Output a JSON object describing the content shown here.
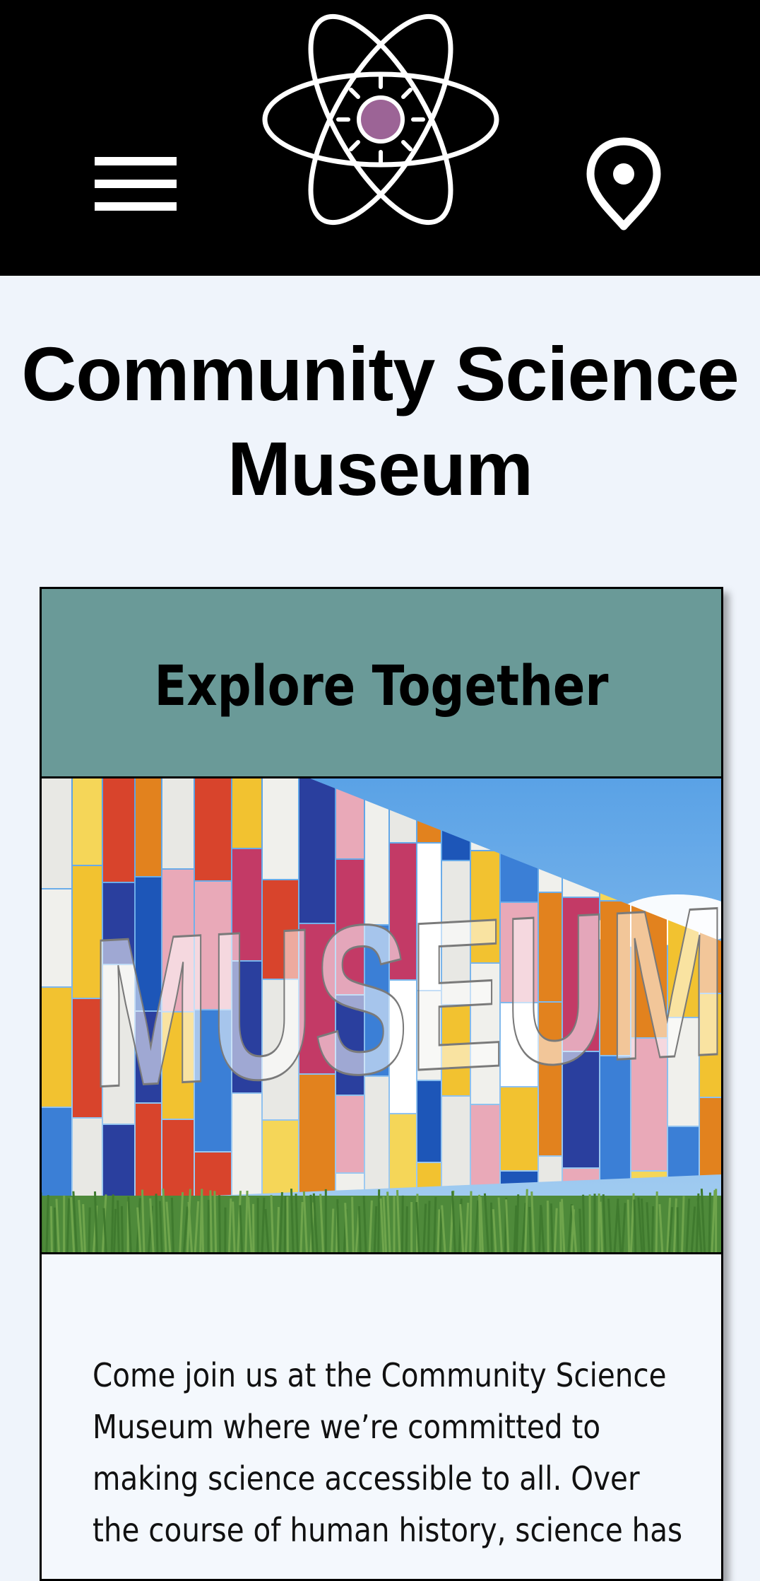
{
  "header": {
    "menu_icon": "hamburger-menu-icon",
    "logo_icon": "atom-sun-logo-icon",
    "location_icon": "map-pin-icon",
    "background_color": "#000000",
    "logo_core_color": "#9c6496"
  },
  "page": {
    "title": "Community Science Museum"
  },
  "card": {
    "title": "Explore Together",
    "header_color": "#6a9a98",
    "image_icon": "museum-facade-image",
    "image_text": "MUSEUM",
    "body": "Come join us at the Community Science Museum where we’re committed to making science accessible to all. Over the course of human history, science has"
  }
}
